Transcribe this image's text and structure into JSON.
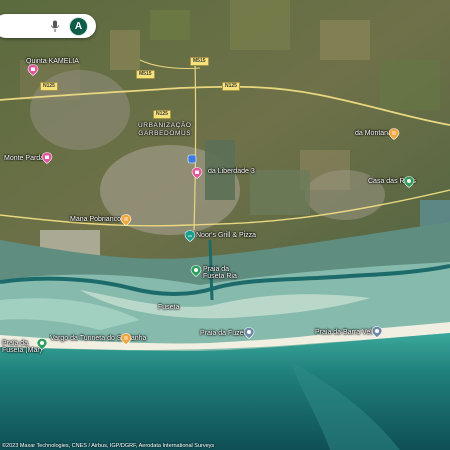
{
  "search": {
    "mic_icon": "microphone-icon",
    "avatar_letter": "A"
  },
  "roads": {
    "m1": "M515",
    "m2": "N125",
    "m3": "N125",
    "m4": "M515",
    "m5": "N125"
  },
  "places": {
    "quinta_kamelia": "Quinta KAMELIA",
    "urbanizacao": "URBANIZAÇÃO\nGARBEDOMUS",
    "monte_pardal": "Monte Pardal",
    "liberdade": "da Liberdade 3",
    "mana": "Mana Pobrianco",
    "pizza": "Noor's Grill & Pizza",
    "praia_fuseta_ria": "Praia da\nFuseta Ria",
    "fuseta": "Fuseta",
    "praia_fuseta_mar": "Praia da\nFuseta (Mar)",
    "restaurant": "Vargo da Tunneta do Saldanha",
    "praia_fuzeta": "Praia da Fuzeta",
    "praia_barra_velha": "Praia da Barra Velha",
    "right_place1": "da Montana",
    "right_place2": "Casa das Ruas"
  },
  "pins": {
    "p1": "shopping-pin-icon",
    "p2": "shopping-pin-icon",
    "p3": "restaurant-pin-icon",
    "p4": "restaurant-pin-icon",
    "p5": "restaurant-pin-icon",
    "p6": "beach-pin-icon",
    "p7": "park-pin-icon",
    "p8": "beach-pin-icon",
    "p9": "beach-pin-icon",
    "p10": "beach-pin-icon",
    "p11": "hotel-pin-icon",
    "p12": "transit-pin-icon"
  },
  "attribution": "©2023 Maxar Technologies, CNES / Airbus, IGP/DGRF, Aerodata International Surveys"
}
